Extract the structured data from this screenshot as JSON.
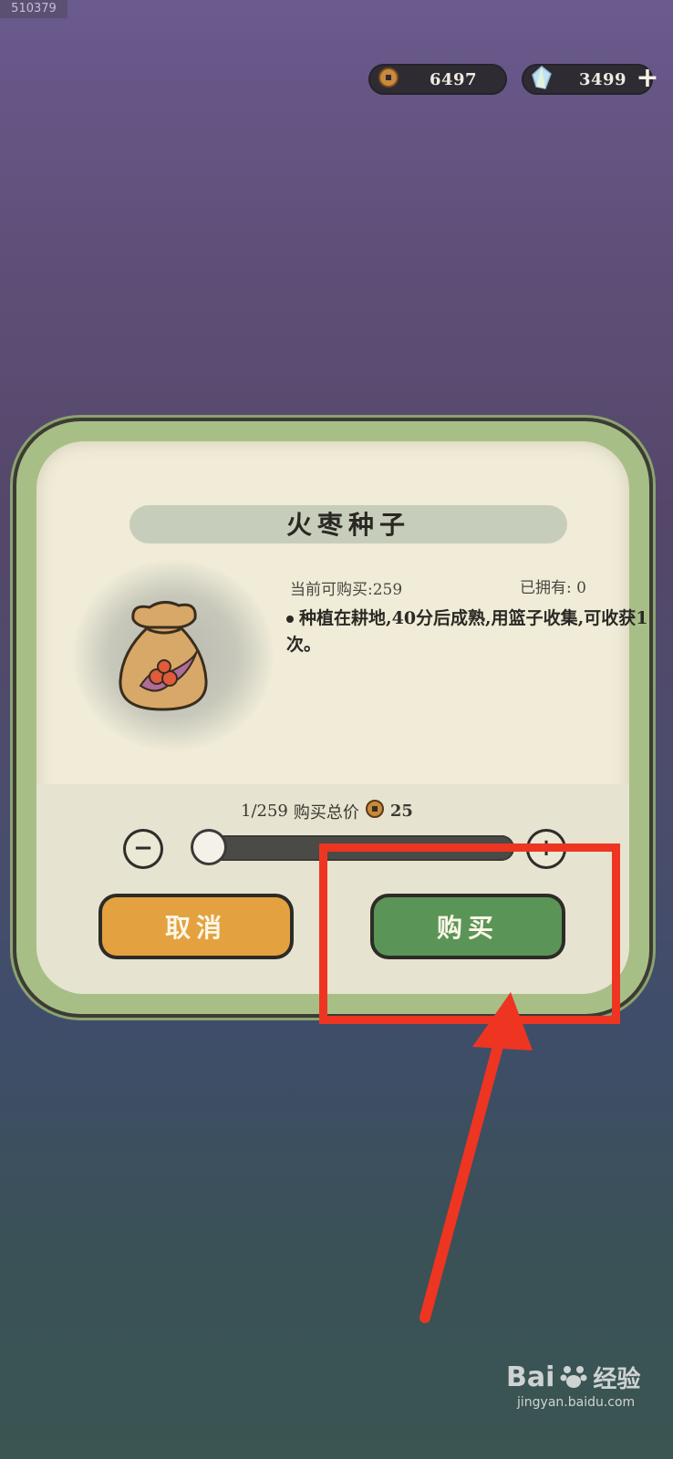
{
  "corner_id": "510379",
  "currency": {
    "coins": "6497",
    "gems": "3499",
    "plus_label": "+"
  },
  "dialog": {
    "title": "火枣种子",
    "buyable": "当前可购买:259",
    "owned": "已拥有: 0",
    "description": "种植在耕地,40分后成熟,用篮子收集,可收获1次。",
    "quantity": "1/259",
    "price_label": "购买总价",
    "price": "25",
    "quantity_selected": 1,
    "quantity_max": 259,
    "cancel_label": "取消",
    "buy_label": "购买"
  },
  "watermark": {
    "brand": "Bai",
    "brand_cn": "经验",
    "site": "jingyan.baidu.com"
  },
  "colors": {
    "annotation": "#ee3522",
    "cancel_button": "#e3a23f",
    "buy_button": "#5b9457"
  }
}
